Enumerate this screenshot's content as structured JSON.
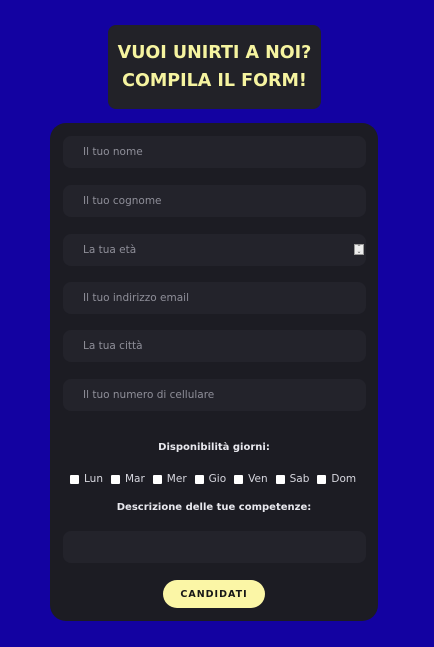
{
  "header": {
    "title_line1": "VUOI UNIRTI A NOI?",
    "title_line2": "COMPILA IL FORM!"
  },
  "form": {
    "fields": [
      {
        "placeholder": "Il tuo nome"
      },
      {
        "placeholder": "Il tuo cognome"
      },
      {
        "placeholder": "La tua età"
      },
      {
        "placeholder": "Il tuo indirizzo email"
      },
      {
        "placeholder": "La tua città"
      },
      {
        "placeholder": "Il tuo numero di cellulare"
      }
    ],
    "availability_label": "Disponibilità giorni:",
    "days": [
      "Lun",
      "Mar",
      "Mer",
      "Gio",
      "Ven",
      "Sab",
      "Dom"
    ],
    "skills_label": "Descrizione delle tue competenze:",
    "skills_value": "",
    "submit_label": "CANDIDATI"
  },
  "colors": {
    "background": "#1302a1",
    "card": "#1c1c23",
    "field": "#23232b",
    "accent": "#f6f4a0"
  }
}
